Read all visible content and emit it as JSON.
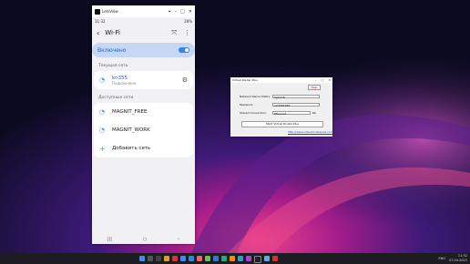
{
  "phone": {
    "window_title": "LetsView",
    "status_time": "11:32",
    "status_right": "28%",
    "header_title": "Wi-Fi",
    "wifi_toggle_label": "Включено",
    "wifi_enabled": true,
    "current_network_header": "Текущая сеть",
    "current_network": {
      "name": "kn355",
      "status": "Подключено"
    },
    "available_header": "Доступные сети",
    "available_networks": [
      {
        "name": "MAGNIT_FREE"
      },
      {
        "name": "MAGNIT_WORK"
      }
    ],
    "add_network_label": "Добавить сеть",
    "icons": {
      "wifi": "wifi-icon",
      "settings": "gear-icon",
      "back": "back-arrow-icon",
      "more": "more-icon",
      "scan": "qr-scan-icon",
      "add": "plus-icon"
    }
  },
  "virtual_router": {
    "title": "Virtual Router Plus",
    "help_button": "Help",
    "ssid_label": "Network Name (SSID):",
    "ssid_value": "hgfrd76",
    "password_label": "Password:",
    "password_value": "123456789",
    "shared_connection_label": "Shared Connection:",
    "shared_connection_value": "Ethernet",
    "refresh_label": "Re",
    "start_button": "Start Virtual Router Plus",
    "link_text": "http://www.virtualrouterplus.com"
  },
  "taskbar": {
    "time": "11:32",
    "date": "07.04.2023",
    "lang": "ENG"
  },
  "colors": {
    "accent": "#3c7ef0",
    "toggle_bg": "#c5d7f2",
    "taskbar": "#1c1c22"
  }
}
